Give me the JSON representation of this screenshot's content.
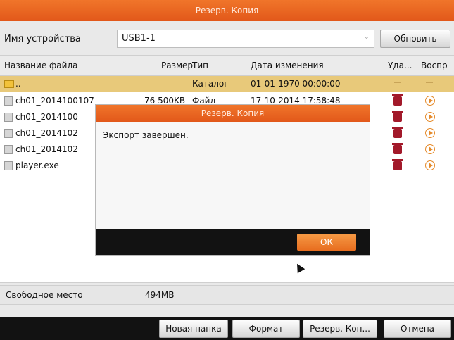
{
  "window": {
    "title": "Резерв. Копия"
  },
  "device": {
    "label": "Имя устройства",
    "value": "USB1-1",
    "refresh_label": "Обновить"
  },
  "table": {
    "headers": [
      "Название файла",
      "Размер",
      "Тип",
      "Дата изменения",
      "Уда...",
      "Воспр"
    ],
    "rows": [
      {
        "name": "..",
        "size": "",
        "type": "Каталог",
        "date": "01-01-1970 00:00:00",
        "kind": "folder"
      },
      {
        "name": "ch01_2014100107",
        "size": "76 500KB",
        "type": "Файл",
        "date": "17-10-2014 17:58:48",
        "kind": "file"
      },
      {
        "name": "ch01_2014100",
        "size": "",
        "type": "",
        "date": "",
        "kind": "file"
      },
      {
        "name": "ch01_2014102",
        "size": "",
        "type": "",
        "date": "",
        "kind": "file"
      },
      {
        "name": "ch01_2014102",
        "size": "",
        "type": "",
        "date": "",
        "kind": "file"
      },
      {
        "name": "player.exe",
        "size": "",
        "type": "",
        "date": "",
        "kind": "file"
      }
    ]
  },
  "free_space": {
    "label": "Свободное место",
    "value": "494MB"
  },
  "footer": {
    "new_folder_label": "Новая папка",
    "format_label": "Формат",
    "backup_label": "Резерв. Коп...",
    "cancel_label": "Отмена"
  },
  "dialog": {
    "title": "Резерв. Копия",
    "message": "Экспорт завершен.",
    "ok_label": "ОК"
  },
  "colors": {
    "accent": "#e8621f",
    "selected_row": "#e8c97a",
    "delete_icon": "#a2192a",
    "play_icon": "#e58a2a"
  }
}
